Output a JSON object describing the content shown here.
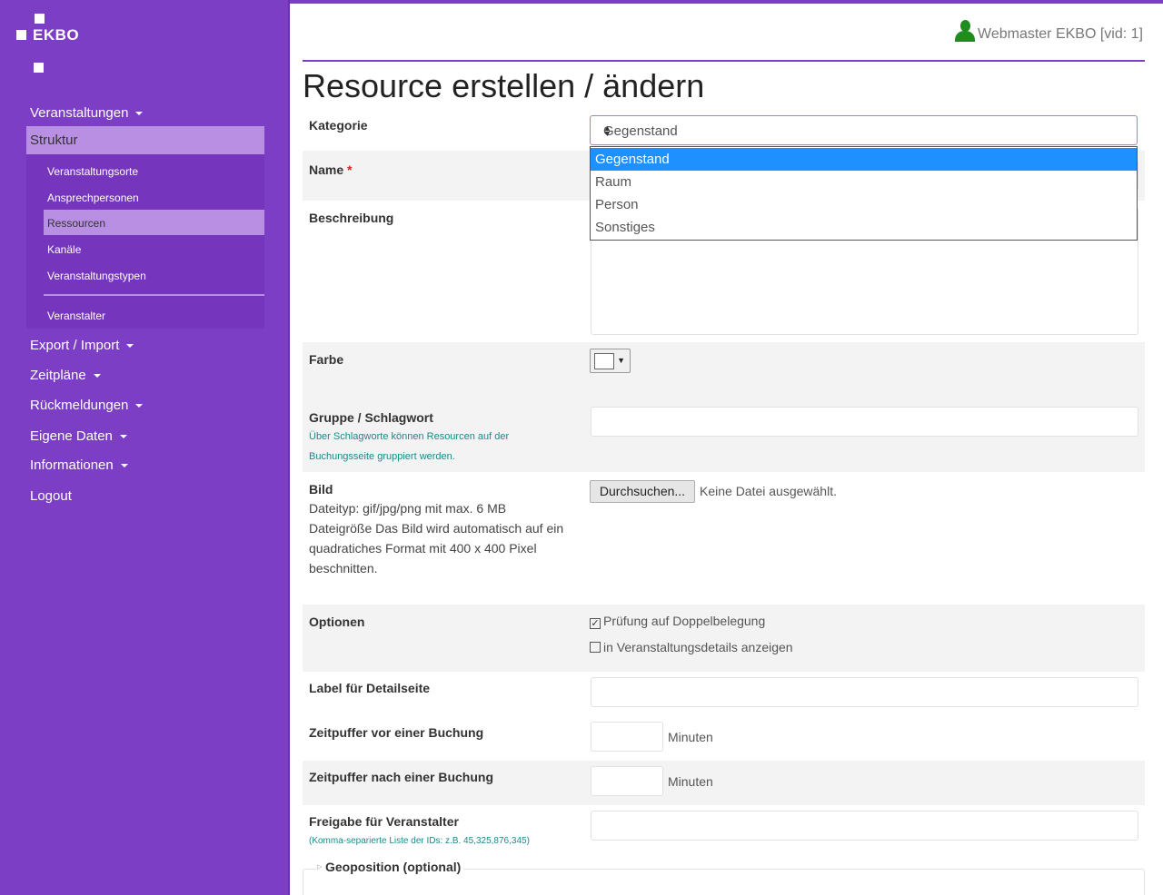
{
  "brand": {
    "name": "EKBO"
  },
  "user": {
    "label": "Webmaster EKBO [vid: 1]"
  },
  "sidebar": {
    "items": [
      {
        "label": "Veranstaltungen"
      },
      {
        "label": "Struktur"
      },
      {
        "label": "Export / Import"
      },
      {
        "label": "Zeitpläne"
      },
      {
        "label": "Rückmeldungen"
      },
      {
        "label": "Eigene Daten"
      },
      {
        "label": "Informationen"
      },
      {
        "label": "Logout"
      }
    ],
    "sub_items": [
      {
        "label": "Veranstaltungsorte"
      },
      {
        "label": "Ansprechpersonen"
      },
      {
        "label": "Ressourcen"
      },
      {
        "label": "Kanäle"
      },
      {
        "label": "Veranstaltungstypen"
      },
      {
        "label": "Veranstalter"
      }
    ]
  },
  "page": {
    "title": "Resource erstellen / ändern"
  },
  "form": {
    "kategorie": {
      "label": "Kategorie",
      "value": "Gegenstand",
      "options": [
        "Gegenstand",
        "Raum",
        "Person",
        "Sonstiges"
      ]
    },
    "name": {
      "label": "Name",
      "required_mark": "*"
    },
    "beschreibung": {
      "label": "Beschreibung"
    },
    "farbe": {
      "label": "Farbe"
    },
    "gruppe": {
      "label": "Gruppe / Schlagwort",
      "hint": "Über Schlagworte können Resourcen auf der Buchungsseite gruppiert werden."
    },
    "bild": {
      "label": "Bild",
      "desc": "Dateityp: gif/jpg/png mit max. 6 MB Dateigröße Das Bild wird automatisch auf ein quadratiches Format mit 400 x 400 Pixel beschnitten.",
      "button": "Durchsuchen...",
      "no_file": "Keine Datei ausgewählt."
    },
    "optionen": {
      "label": "Optionen",
      "check1": {
        "label": "Prüfung auf Doppelbelegung",
        "checked": true
      },
      "check2": {
        "label": "in Veranstaltungsdetails anzeigen",
        "checked": false
      }
    },
    "label_detail": {
      "label": "Label für Detailseite"
    },
    "puffer_vor": {
      "label": "Zeitpuffer vor einer Buchung",
      "unit": "Minuten"
    },
    "puffer_nach": {
      "label": "Zeitpuffer nach einer Buchung",
      "unit": "Minuten"
    },
    "freigabe": {
      "label": "Freigabe für Veranstalter",
      "hint": "(Komma-separierte Liste der IDs: z.B. 45,325,876,345)"
    },
    "geo": {
      "label": "Geoposition (optional)"
    }
  }
}
